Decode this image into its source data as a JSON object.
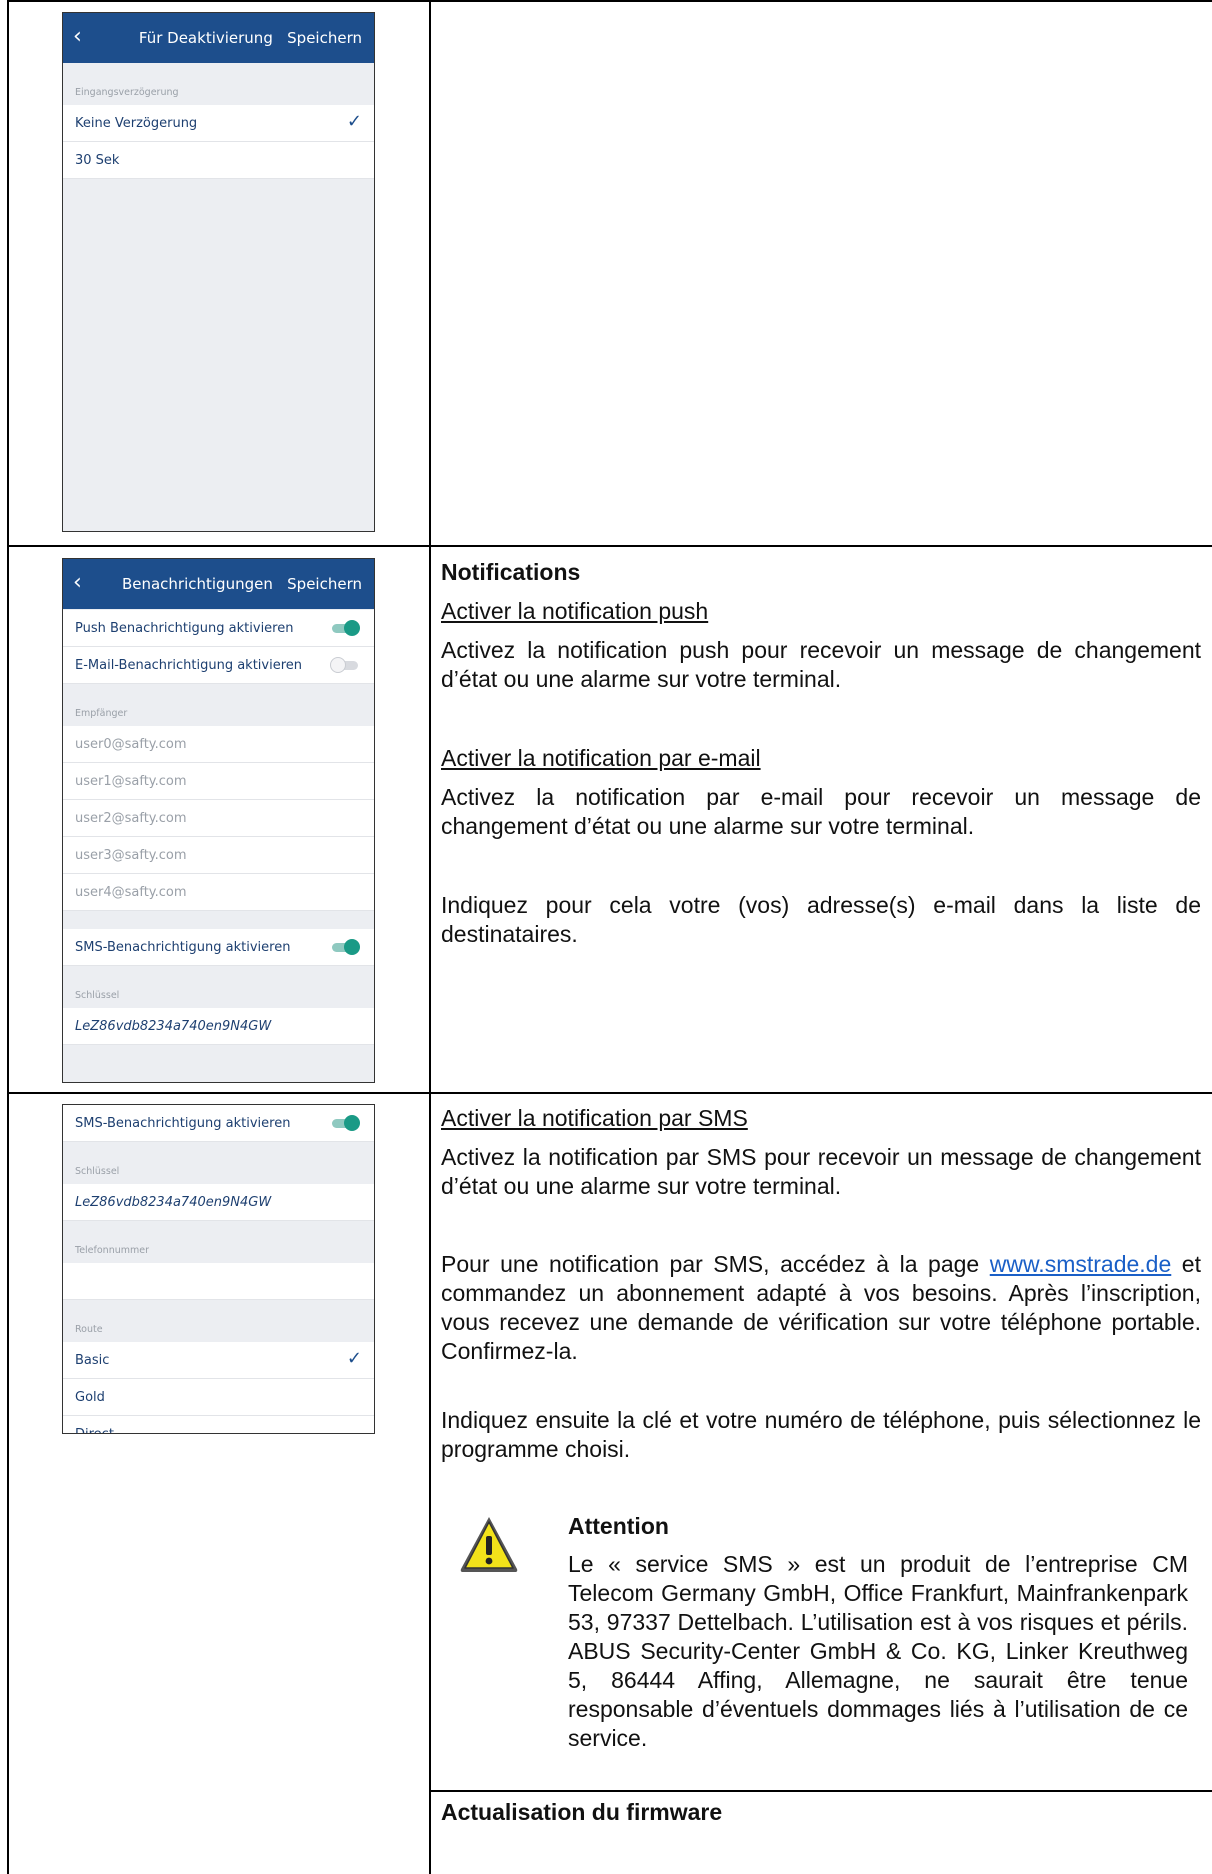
{
  "phone1": {
    "title": "Für Deaktivierung",
    "save": "Speichern",
    "back": "‹",
    "section": "Eingangsverzögerung",
    "options": [
      "Keine Verzögerung",
      "30 Sek"
    ],
    "selected_icon": "check-icon"
  },
  "phone2": {
    "title": "Benachrichtigungen",
    "save": "Speichern",
    "back": "‹",
    "push_label": "Push Benachrichtigung aktivieren",
    "push_on": true,
    "email_label": "E-Mail-Benachrichtigung aktivieren",
    "email_on": false,
    "recipients_section": "Empfänger",
    "recipients": [
      "user0@safty.com",
      "user1@safty.com",
      "user2@safty.com",
      "user3@safty.com",
      "user4@safty.com"
    ],
    "sms_label": "SMS-Benachrichtigung aktivieren",
    "sms_on": true,
    "key_section": "Schlüssel",
    "key_value": "LeZ86vdb8234a740en9N4GW"
  },
  "phone3": {
    "sms_label": "SMS-Benachrichtigung aktivieren",
    "key_section": "Schlüssel",
    "key_value": "LeZ86vdb8234a740en9N4GW",
    "phone_section": "Telefonnummer",
    "route_section": "Route",
    "routes": [
      "Basic",
      "Gold",
      "Direct"
    ]
  },
  "notifications": {
    "heading": "Notifications",
    "push_heading": "Activer la notification push",
    "push_text": "Activez la notification push pour recevoir un message de changement d’état ou une alarme sur votre terminal.",
    "email_heading": "Activer la notification par e-mail",
    "email_text": "Activez la notification par e-mail pour recevoir un message de changement d’état ou une alarme sur votre terminal.",
    "email_text2": "Indiquez pour cela votre (vos) adresse(s) e-mail dans la liste de destinataires."
  },
  "sms": {
    "heading": "Activer la notification par SMS",
    "text1": "Activez la notification par SMS pour recevoir un message de changement d’état ou une alarme sur votre terminal.",
    "text2_pre": "Pour une notification par SMS, accédez à la page ",
    "link": "www.smstrade.de",
    "text2_post": " et commandez un abonnement adapté à vos besoins. Après l’inscription, vous recevez une demande de vérification sur votre téléphone portable. Confirmez-la.",
    "text3": "Indiquez ensuite la clé et votre numéro de téléphone, puis sélectionnez le programme choisi."
  },
  "attention": {
    "icon": "warning-icon",
    "heading": "Attention",
    "text": "Le « service SMS » est un produit de l’entreprise CM Telecom Germany GmbH, Office Frankfurt, Mainfrankenpark 53, 97337 Dettelbach. L’utilisation est à vos risques et périls. ABUS Security-Center GmbH & Co. KG, Linker Kreuthweg 5, 86444 Affing, Allemagne, ne saurait être tenue responsable d’éventuels dommages liés à l’utilisation de ce service."
  },
  "firmware": {
    "heading": "Actualisation du firmware"
  },
  "colors": {
    "app_header": "#1d4e8c",
    "toggle_on": "#1a9a86",
    "link": "#1a5fc7"
  }
}
